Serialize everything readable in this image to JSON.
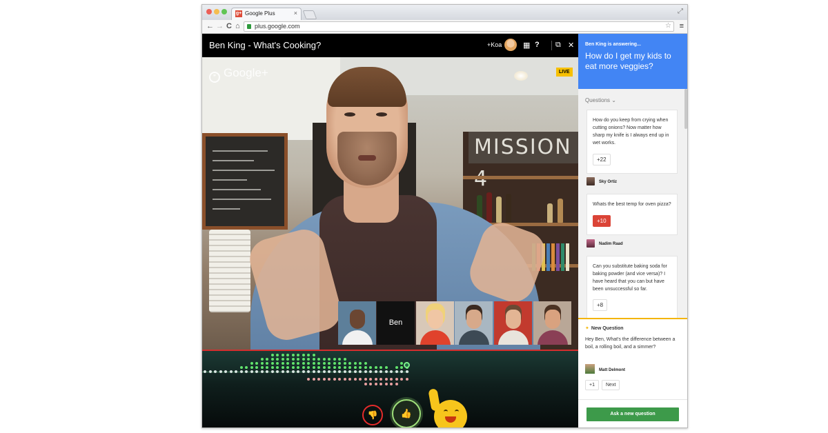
{
  "browser": {
    "tab_title": "Google Plus",
    "favicon_text": "g+",
    "tab_close": "×",
    "url": "plus.google.com",
    "fullscreen_glyph": "⤢",
    "back_glyph": "←",
    "forward_glyph": "→",
    "reload_glyph": "C",
    "home_glyph": "⌂",
    "star_glyph": "☆",
    "menu_glyph": "≡"
  },
  "hangout": {
    "title": "Ben King - What's Cooking?",
    "invite_label": "+Koa",
    "apps_glyph": "▦",
    "help_glyph": "?",
    "popout_glyph": "⧉",
    "close_glyph": "✕"
  },
  "video": {
    "logo_text": "Google+",
    "logo_icon": "❞",
    "live_badge": "LIVE",
    "sign_text": "MISSION 4",
    "participants": [
      {
        "type": "video",
        "icon": "person-1"
      },
      {
        "type": "label",
        "name": "Ben"
      },
      {
        "type": "video",
        "icon": "person-2"
      },
      {
        "type": "video",
        "icon": "person-3"
      },
      {
        "type": "video",
        "icon": "person-4"
      },
      {
        "type": "video",
        "icon": "person-5"
      }
    ]
  },
  "reactions": {
    "dislike_glyph": "👎",
    "like_glyph": "👍",
    "mascot_icon": "smiley-mascot-icon"
  },
  "qa_panel": {
    "answering_label": "Ben King is answering...",
    "current_question": "How do I get my kids to eat more veggies?",
    "questions_label": "Questions",
    "questions": [
      {
        "text": "How do you keep from crying when cutting onions? Now matter how sharp my knife is I always end up in wet works.",
        "votes": "+22",
        "voted": false,
        "asker": "Sky Ortiz"
      },
      {
        "text": "Whats the best temp for oven pizza?",
        "votes": "+10",
        "voted": true,
        "asker": "Nadim Raad"
      },
      {
        "text": "Can you substitute baking soda for baking powder (and vice versa)? I have heard that you can but have been unsuccessful so far.",
        "votes": "+8",
        "voted": false,
        "asker": ""
      }
    ],
    "new_question": {
      "title": "New Question",
      "text": "Hey Ben, What's the difference between a boil, a rolling boil, and a simmer?",
      "asker": "Matt Delmont",
      "plus_one": "+1",
      "next": "Next"
    },
    "ask_button": "Ask a new question"
  },
  "colors": {
    "panel_blue": "#4285f4",
    "vote_red": "#db4437",
    "ask_green": "#3d9a4a",
    "new_question_accent": "#f4b400",
    "live_yellow": "#f7c000"
  }
}
